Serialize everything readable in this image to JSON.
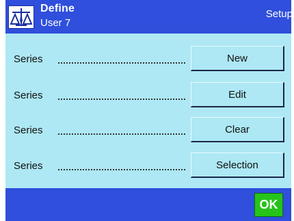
{
  "header": {
    "icon": "balance-scale-icon",
    "title": "Define",
    "subtitle": "User 7",
    "mode": "Setup"
  },
  "rows": [
    {
      "label": "Series",
      "button": "New"
    },
    {
      "label": "Series",
      "button": "Edit"
    },
    {
      "label": "Series",
      "button": "Clear"
    },
    {
      "label": "Series",
      "button": "Selection"
    }
  ],
  "footer": {
    "ok_label": "OK"
  },
  "colors": {
    "bar": "#2f4fdc",
    "panel": "#ade8f4",
    "ok": "#26c41a"
  }
}
